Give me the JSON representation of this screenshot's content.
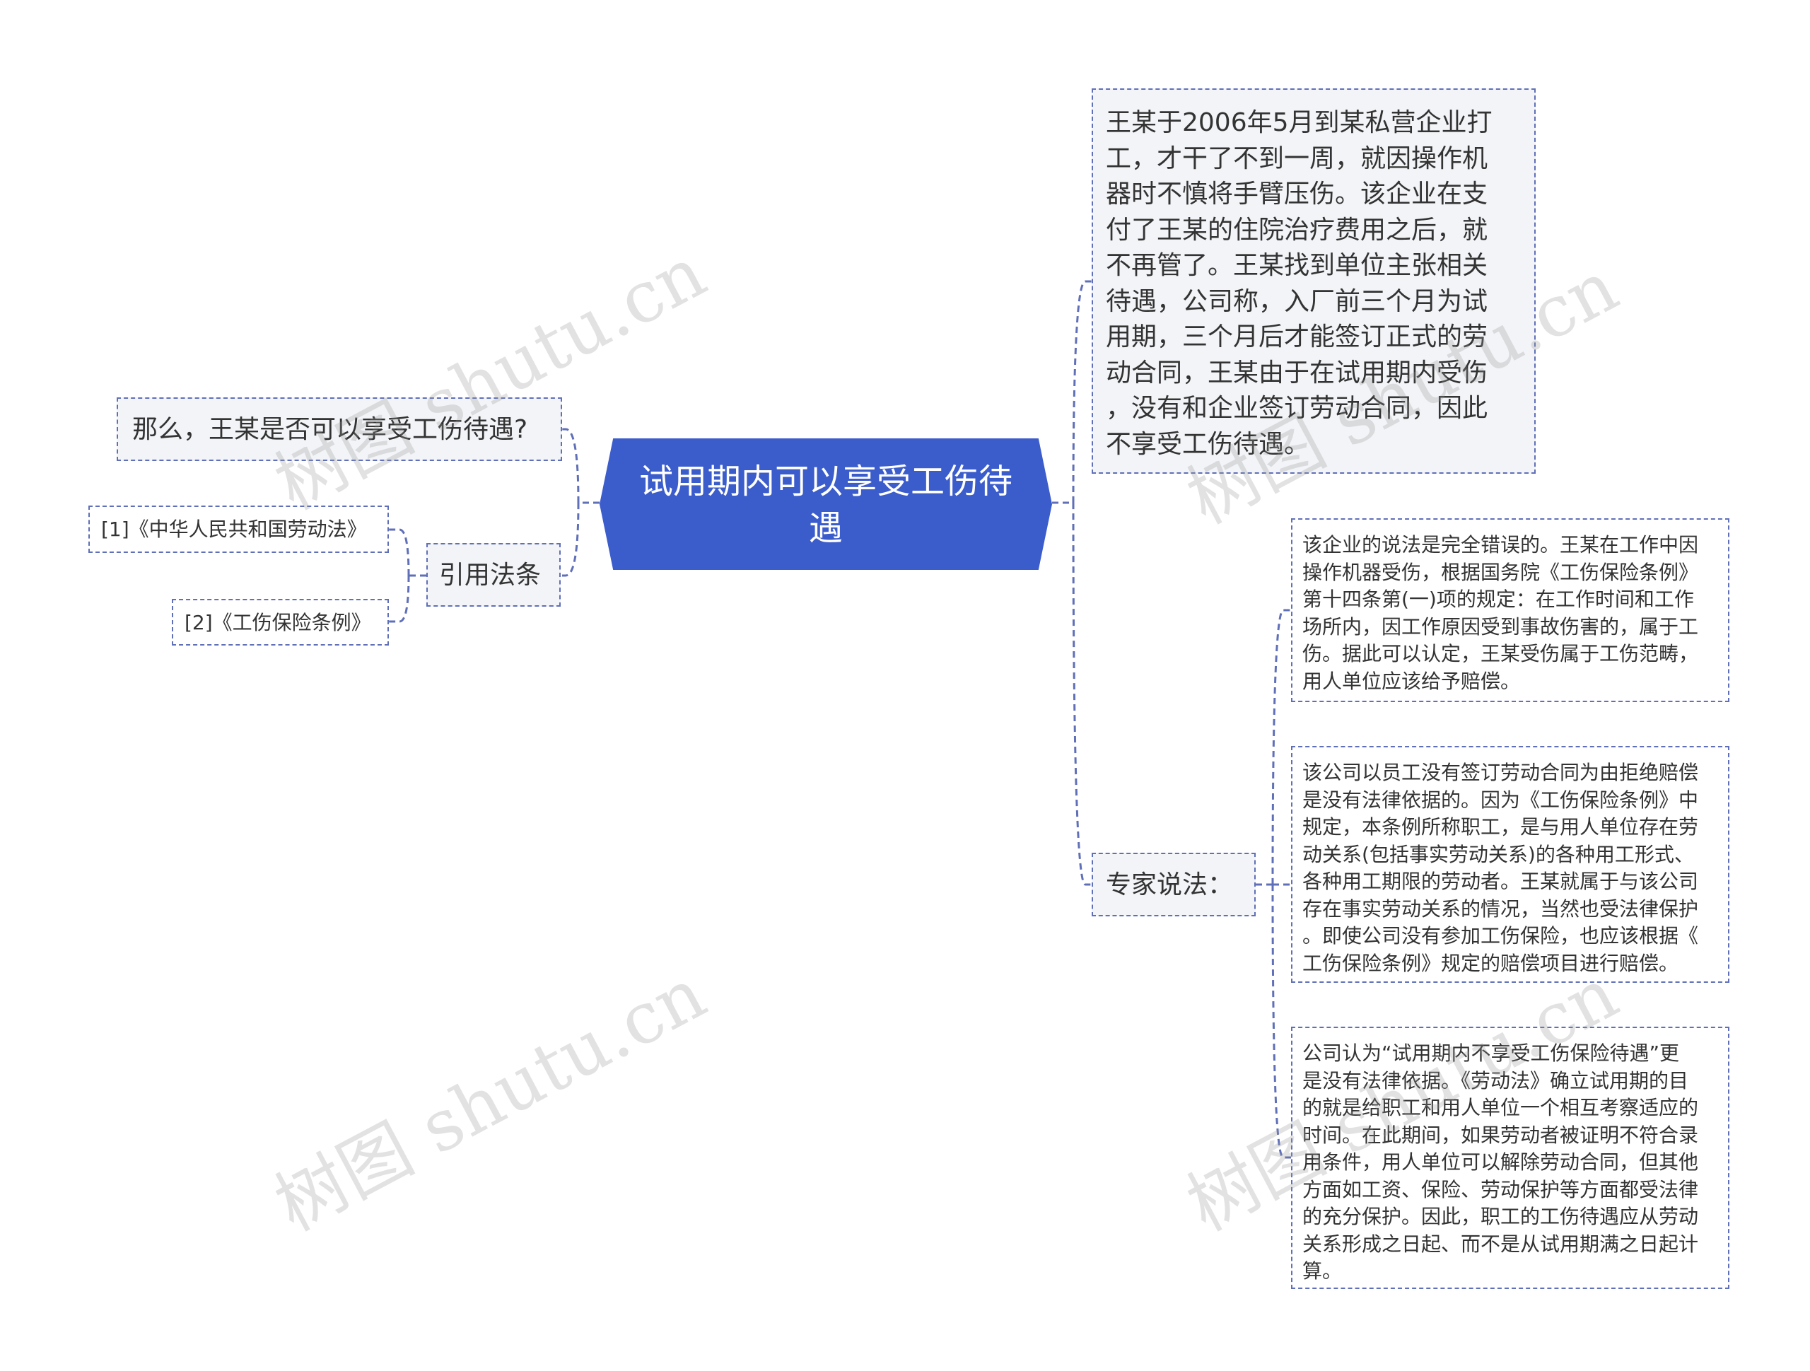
{
  "root": {
    "title": "试用期内可以享受工伤待遇",
    "fill_color": "#3b5ccb"
  },
  "branch_color": "#5f6fb8",
  "left": {
    "question": "那么，王某是否可以享受工伤待遇?",
    "citations": {
      "label": "引用法条",
      "items": [
        "[1]《中华人民共和国劳动法》",
        "[2]《工伤保险条例》"
      ]
    }
  },
  "right": {
    "case_text": "王某于2006年5月到某私营企业打\n工，才干了不到一周，就因操作机\n器时不慎将手臂压伤。该企业在支\n付了王某的住院治疗费用之后，就\n不再管了。王某找到单位主张相关\n待遇，公司称，入厂前三个月为试\n用期，三个月后才能签订正式的劳\n动合同，王某由于在试用期内受伤\n，没有和企业签订劳动合同，因此\n不享受工伤待遇。",
    "expert": {
      "label": "专家说法：",
      "opinions": [
        "该企业的说法是完全错误的。王某在工作中因\n操作机器受伤，根据国务院《工伤保险条例》\n第十四条第(一)项的规定：在工作时间和工作\n场所内，因工作原因受到事故伤害的，属于工\n伤。据此可以认定，王某受伤属于工伤范畴，\n用人单位应该给予赔偿。",
        "该公司以员工没有签订劳动合同为由拒绝赔偿\n是没有法律依据的。因为《工伤保险条例》中\n规定，本条例所称职工，是与用人单位存在劳\n动关系(包括事实劳动关系)的各种用工形式、\n各种用工期限的劳动者。王某就属于与该公司\n存在事实劳动关系的情况，当然也受法律保护\n。即使公司没有参加工伤保险，也应该根据《\n工伤保险条例》规定的赔偿项目进行赔偿。",
        "公司认为“试用期内不享受工伤保险待遇”更\n是没有法律依据。《劳动法》确立试用期的目\n的就是给职工和用人单位一个相互考察适应的\n时间。在此期间，如果劳动者被证明不符合录\n用条件，用人单位可以解除劳动合同，但其他\n方面如工资、保险、劳动保护等方面都受法律\n的充分保护。因此，职工的工伤待遇应从劳动\n关系形成之日起、而不是从试用期满之日起计\n算。"
      ]
    }
  },
  "watermark": "树图 shutu.cn"
}
